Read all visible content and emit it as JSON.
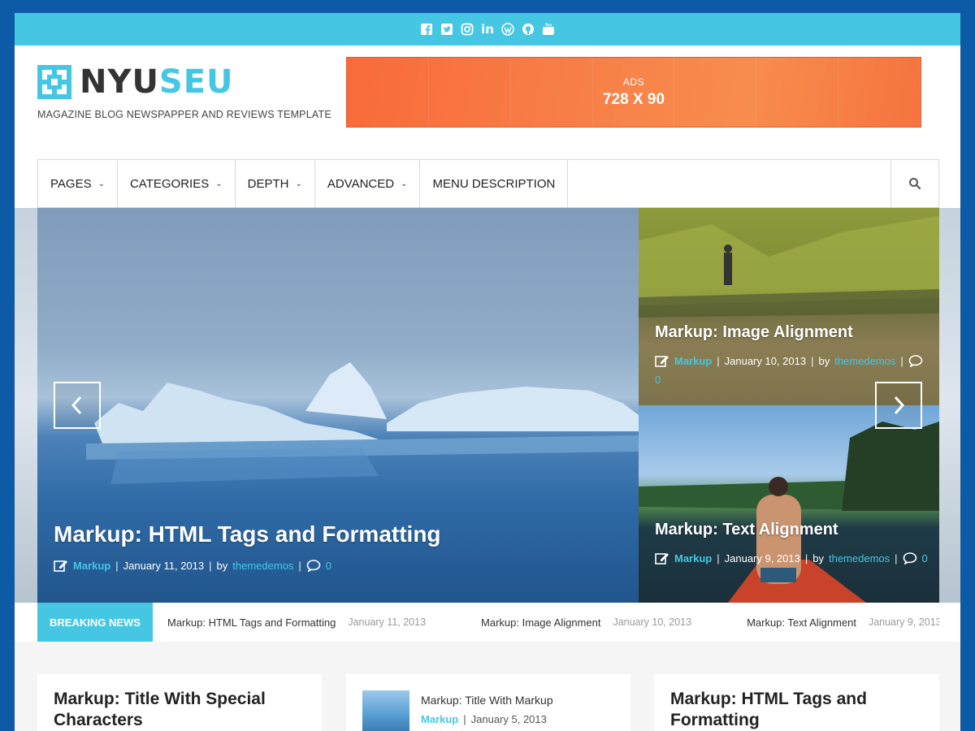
{
  "social": [
    "facebook-icon",
    "twitter-icon",
    "instagram-icon",
    "linkedin-icon",
    "wordpress-icon",
    "github-icon",
    "youtube-icon"
  ],
  "social_labels": {
    "linkedin": "in",
    "youtube": "You"
  },
  "brand": {
    "logo_a": "NYU",
    "logo_b": "SEU",
    "tagline": "MAGAZINE BLOG NEWSPAPPER AND REVIEWS TEMPLATE"
  },
  "ad": {
    "label": "ADS",
    "size": "728 X 90"
  },
  "nav": {
    "items": [
      {
        "label": "PAGES",
        "dropdown": true
      },
      {
        "label": "CATEGORIES",
        "dropdown": true
      },
      {
        "label": "DEPTH",
        "dropdown": true
      },
      {
        "label": "ADVANCED",
        "dropdown": true
      },
      {
        "label": "MENU DESCRIPTION",
        "dropdown": false
      }
    ]
  },
  "slides": {
    "main": {
      "title": "Markup: HTML Tags and Formatting",
      "category": "Markup",
      "date": "January 11, 2013",
      "by": "by",
      "author": "themedemos",
      "comments": "0"
    },
    "side1": {
      "title": "Markup: Image Alignment",
      "category": "Markup",
      "date": "January 10, 2013",
      "by": "by",
      "author": "themedemos",
      "comments": "0"
    },
    "side2": {
      "title": "Markup: Text Alignment",
      "category": "Markup",
      "date": "January 9, 2013",
      "by": "by",
      "author": "themedemos",
      "comments": "0"
    }
  },
  "breaking": {
    "label": "BREAKING NEWS",
    "items": [
      {
        "title": "Markup: HTML Tags and Formatting",
        "date": "January 11, 2013"
      },
      {
        "title": "Markup: Image Alignment",
        "date": "January 10, 2013"
      },
      {
        "title": "Markup: Text Alignment",
        "date": "January 9, 2013"
      }
    ]
  },
  "cards": {
    "c1": {
      "title": "Markup: Title With Special Characters"
    },
    "c2": {
      "title": "Markup: Title With Markup",
      "category": "Markup",
      "date": "January 5, 2013"
    },
    "c3": {
      "title": "Markup: HTML Tags and Formatting"
    }
  },
  "colors": {
    "accent": "#45c7e3",
    "frame": "#0d5aa7",
    "ad": "#f7743f"
  }
}
